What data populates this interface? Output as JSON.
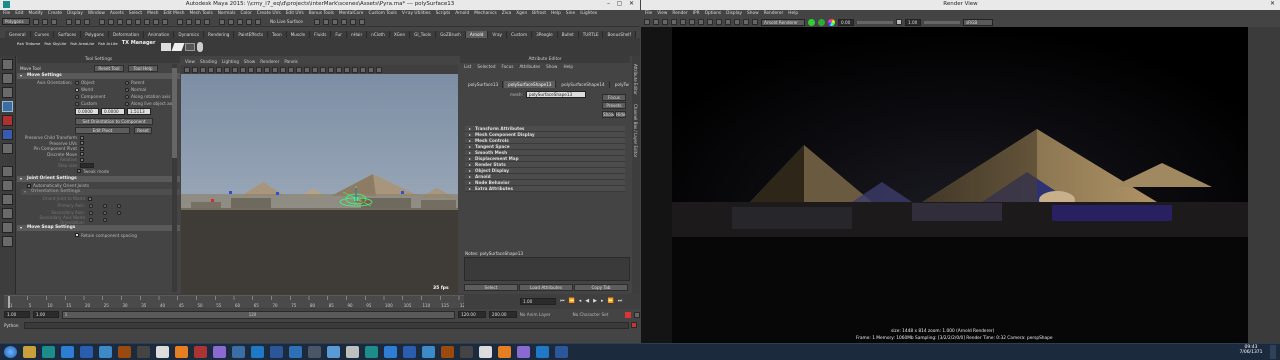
{
  "maya": {
    "title": "Autodesk Maya 2015: \\\\cmy_i7_eq\\d\\projects\\interMark\\scenes\\Assets\\Pyra.ma*  ---  polySurface13",
    "menus": [
      "File",
      "Edit",
      "Modify",
      "Create",
      "Display",
      "Window",
      "Assets",
      "Select",
      "Mesh",
      "Edit Mesh",
      "Mesh Tools",
      "Normals",
      "Color",
      "Create UVs",
      "Edit UVs",
      "Bonus Tools",
      "MentalCore",
      "Custom Tools",
      "V-ray Utilities",
      "Scripts",
      "Arnold",
      "Mechanics",
      "Ziva",
      "Xgen",
      "Bifrost",
      "Help",
      "Sine",
      "iLightex"
    ],
    "mode_menu": "Polygons",
    "live_surface": "No Live Surface",
    "shelf_tabs": [
      "General",
      "Curves",
      "Surfaces",
      "Polygons",
      "Deformation",
      "Animation",
      "Dynamics",
      "Rendering",
      "PaintEffects",
      "Toon",
      "Muscle",
      "Fluids",
      "Fur",
      "nHair",
      "nCloth",
      "XGen",
      "GI_Tools",
      "GoZBrush",
      "Arnold",
      "Vray",
      "Custom",
      "3Poogle",
      "Bullet",
      "TURTLE",
      "BonusShelf"
    ],
    "selected_shelf": "Arnold",
    "shelf_buttons": [
      "Rsh Tridome",
      "Rsh SkyLite",
      "Rsh AreaLite",
      "Rsh ArLite",
      "TX Manager"
    ]
  },
  "tool_settings": {
    "panel_title": "Tool Settings",
    "tool_name": "Move Tool",
    "reset_label": "Reset Tool",
    "help_label": "Tool Help",
    "move_settings": "Move Settings",
    "axis_orientation": "Axis Orientation:",
    "radio_left": [
      "Object",
      "World",
      "Component",
      "Custom"
    ],
    "radio_right": [
      "Parent",
      "Normal",
      "Along rotation axis",
      "Along live object axis"
    ],
    "values": [
      "0.0000",
      "0.0000",
      "1.5113"
    ],
    "set_orient_btn": "Set Orientation to Component",
    "edit_pivot": "Edit Pivot",
    "reset": "Reset",
    "preserve": [
      "Preserve Child Transform",
      "Preserve UVs",
      "Pin Component Pivot",
      "Discrete Move",
      "Relative",
      "Step size"
    ],
    "tweak_mode": "Tweak mode",
    "joint_orient": "Joint Orient Settings",
    "auto_orient": "Automatically Orient Joints",
    "orientation_settings": "Orientation Settings",
    "orient_rows": [
      "Orient Joint to World",
      "Primary Axis:",
      "Secondary Axis:",
      "Secondary Axis World Orientation:"
    ],
    "move_snap": "Move Snap Settings",
    "retain_spacing": "Retain component spacing"
  },
  "viewport": {
    "menus": [
      "View",
      "Shading",
      "Lighting",
      "Show",
      "Renderer",
      "Panels"
    ],
    "fps": "35 fps"
  },
  "attribute_editor": {
    "title": "Attribute Editor",
    "menus": [
      "List",
      "Selected",
      "Focus",
      "Attributes",
      "Show",
      "Help"
    ],
    "tabs": [
      "polySurface13",
      "polySurfaceShape13",
      "polySurfaceShape14",
      "polyTw"
    ],
    "mesh_label": "mesh:",
    "mesh_value": "polySurfaceShape13",
    "focus_btn": "Focus",
    "presets_btn": "Presets",
    "show_btn": "Show",
    "hide_btn": "Hide",
    "sections": [
      "Transform Attributes",
      "Mesh Component Display",
      "Mesh Controls",
      "Tangent Space",
      "Smooth Mesh",
      "Displacement Map",
      "Render Stats",
      "Object Display",
      "Arnold",
      "Node Behavior",
      "Extra Attributes"
    ],
    "notes": "Notes: polySurfaceShape13",
    "select_btn": "Select",
    "load_btn": "Load Attributes",
    "copy_btn": "Copy Tab"
  },
  "side_tabs": [
    "Attribute Editor",
    "Channel Box / Layer Editor"
  ],
  "time_slider": {
    "ticks": [
      "1",
      "5",
      "10",
      "15",
      "20",
      "25",
      "30",
      "35",
      "40",
      "45",
      "50",
      "55",
      "60",
      "65",
      "70",
      "75",
      "80",
      "85",
      "90",
      "95",
      "100",
      "105",
      "110",
      "115",
      "120"
    ],
    "current": "1.00"
  },
  "range_slider": {
    "start": "1.00",
    "start2": "1.00",
    "bar_start": "1",
    "bar_end": "120",
    "end": "120.00",
    "end2": "200.00",
    "anim_layer": "No Anim Layer",
    "char_set": "No Character Set"
  },
  "command_line": {
    "lang": "Python"
  },
  "render_view": {
    "title": "Render View",
    "menus": [
      "File",
      "View",
      "Render",
      "IPR",
      "Options",
      "Display",
      "Show",
      "Renderer",
      "Help"
    ],
    "renderer": "Arnold Renderer",
    "exposure": "0.00",
    "gamma": "1.00",
    "display": "sRGB gamma",
    "info": "size: 1448 x 814  zoom: 1.000        (Arnold Renderer)",
    "stats": "Frame: 1     Memory: 1060Mb     Sampling: [3/2/2/2/0/0]     Render Time: 0:32     Camera: perspShape"
  },
  "taskbar": {
    "time": "09:43",
    "date": "7/06/1371"
  },
  "colors": {
    "maya_bg": "#444444",
    "selected_shelf": "#5d5d5d",
    "sky_top": "#7d8ea4",
    "sky_bottom": "#9aa8b8",
    "selection_green": "#3cff6a",
    "taskbar": "#1c2a3d"
  }
}
